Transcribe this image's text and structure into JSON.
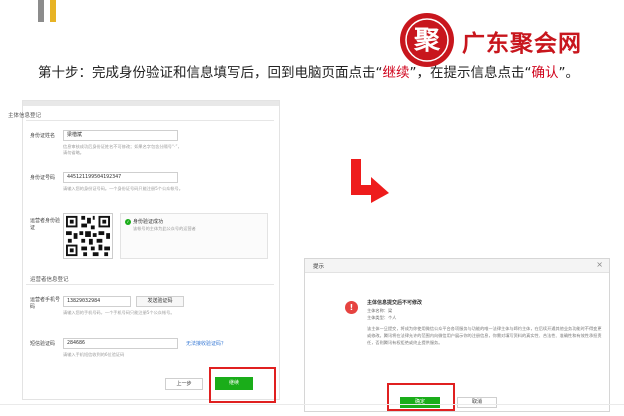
{
  "logo": {
    "text": "广东聚会网",
    "mark_char": "聚"
  },
  "instruction": {
    "part1": "第十步：完成身份验证和信息填写后，回到电脑页面点击“",
    "keyword1": "继续",
    "part2": "”，在提示信息点击“",
    "keyword2": "确认",
    "part3": "”。"
  },
  "form": {
    "subject_section": "主体信息登记",
    "name_label": "身份证姓名",
    "name_value": "梁楷斌",
    "name_hint": "信息审核成功后身份证姓名不可修改；如果名字包含分隔号“·”，请勿省略。",
    "id_label": "身份证号码",
    "id_value": "445121199504192347",
    "id_hint": "请输入您的身份证号码。一个身份证号码只能注册5个公众帐号。",
    "verify_label": "运营者身份验证",
    "verify_title": "身份验证成功",
    "verify_desc": "该帐号的主体为此公众号的运营者",
    "operator_section": "运营者信息登记",
    "phone_label": "运营者手机号码",
    "phone_value": "13829032984",
    "send_code_btn": "发送验证码",
    "phone_hint": "请输入您的手机号码，一个手机号码只能注册5个公众帐号。",
    "sms_label": "短信验证码",
    "sms_value": "284686",
    "sms_link": "无法接收验证码？",
    "sms_hint": "请输入手机短信收到的6位验证码",
    "prev_btn": "上一步",
    "continue_btn": "继续"
  },
  "dialog": {
    "title": "提示",
    "close": "×",
    "warn_icon": "!",
    "headline": "主体信息提交后不可修改",
    "subject_name": "主体名称：梁",
    "subject_type": "主体类型：个人",
    "para": "该主体一旦提交，将成为你使用微信公众平台各项服务与功能的唯一法律主体与缔约主体，在后续开通其他业务功能时不得变更或修改。腾讯将在法律允许的范围内向微信用户展示你的注册信息，你需对填写资料的真实性、合法性、准确性和有效性承担责任，否则腾讯有权拒绝或终止提供服务。",
    "ok_btn": "确定",
    "cancel_btn": "取消"
  },
  "colors": {
    "accent_red": "#d0021b",
    "wechat_green": "#1aad19",
    "highlight": "#e02020",
    "logo_red": "#c8161d"
  }
}
